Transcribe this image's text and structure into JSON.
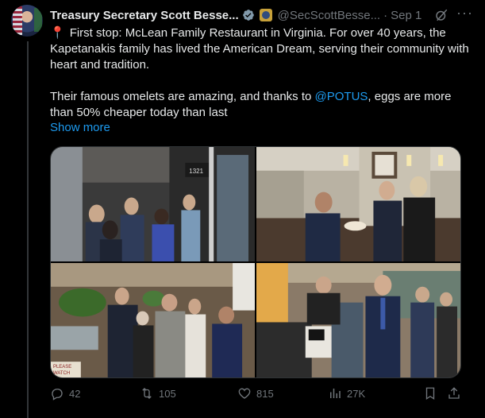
{
  "tweet": {
    "author_name": "Treasury Secretary Scott Besse...",
    "handle": "@SecScottBesse...",
    "separator": "·",
    "date": "Sep 1",
    "pin_emoji": "📍",
    "line1": "First stop: McLean Family Restaurant in Virginia. For over 40 years, the Kapetanakis family has lived the American Dream, serving their community with heart and tradition.",
    "line2_before": "Their famous omelets are amazing, and thanks to",
    "mention": "@POTUS",
    "line2_after": ", eggs are more than 50% cheaper today than last",
    "show_more": "Show more"
  },
  "photos": {
    "p1_sign": "1321",
    "p3_sign_line1": "PLEASE",
    "p3_sign_line2": "WATCH"
  },
  "actions": {
    "replies": "42",
    "reposts": "105",
    "likes": "815",
    "views": "27K"
  },
  "colors": {
    "background": "#000000",
    "text": "#e7e9ea",
    "muted": "#71767b",
    "link": "#1d9bf0",
    "verified_gray": "#829aab"
  }
}
